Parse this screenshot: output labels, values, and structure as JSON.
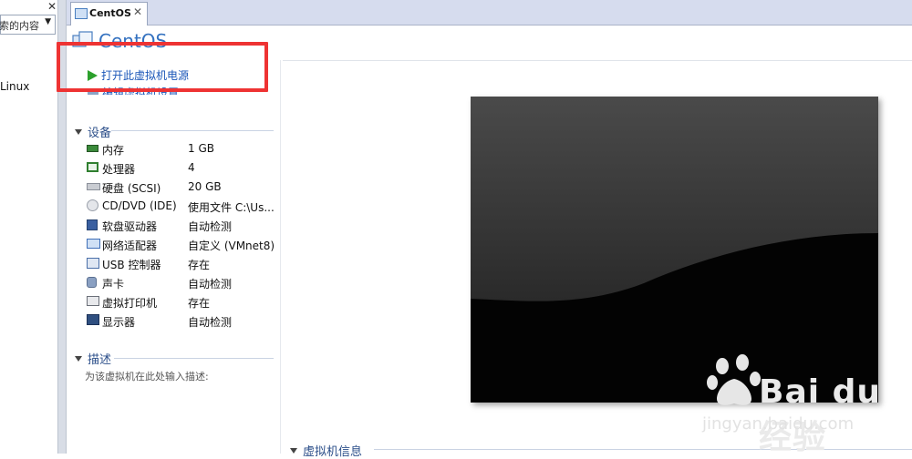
{
  "library": {
    "search_text": "索的内容",
    "item_label": "Linux"
  },
  "tab": {
    "label": "CentOS"
  },
  "vm": {
    "title": "CentOS",
    "actions": {
      "power_on": "打开此虚拟机电源",
      "edit_settings": "编辑虚拟机设置"
    }
  },
  "devices": {
    "heading": "设备",
    "items": [
      {
        "name": "内存",
        "value": "1 GB",
        "icon": "memory-icon",
        "color": "#3a8a3a"
      },
      {
        "name": "处理器",
        "value": "4",
        "icon": "cpu-icon",
        "color": "#2f7f2f"
      },
      {
        "name": "硬盘 (SCSI)",
        "value": "20 GB",
        "icon": "harddisk-icon",
        "color": "#8a8f99"
      },
      {
        "name": "CD/DVD (IDE)",
        "value": "使用文件 C:\\Us...",
        "icon": "cd-icon",
        "color": "#9aa0aa"
      },
      {
        "name": "软盘驱动器",
        "value": "自动检测",
        "icon": "floppy-icon",
        "color": "#3a5fa0"
      },
      {
        "name": "网络适配器",
        "value": "自定义 (VMnet8)",
        "icon": "network-icon",
        "color": "#3f6fb8"
      },
      {
        "name": "USB 控制器",
        "value": "存在",
        "icon": "usb-icon",
        "color": "#4a6fa8"
      },
      {
        "name": "声卡",
        "value": "自动检测",
        "icon": "speaker-icon",
        "color": "#5a6f90"
      },
      {
        "name": "虚拟打印机",
        "value": "存在",
        "icon": "printer-icon",
        "color": "#6a6f78"
      },
      {
        "name": "显示器",
        "value": "自动检测",
        "icon": "monitor-icon",
        "color": "#3f5f90"
      }
    ]
  },
  "description": {
    "heading": "描述",
    "placeholder": "为该虚拟机在此处输入描述:"
  },
  "vm_info": {
    "heading": "虚拟机信息"
  },
  "colors": {
    "highlight": "#ee3333",
    "title_blue": "#3572c0",
    "play_green": "#2ca02c"
  },
  "watermark": {
    "logo": "Bai du 经验",
    "url": "jingyan.baidu.com"
  }
}
